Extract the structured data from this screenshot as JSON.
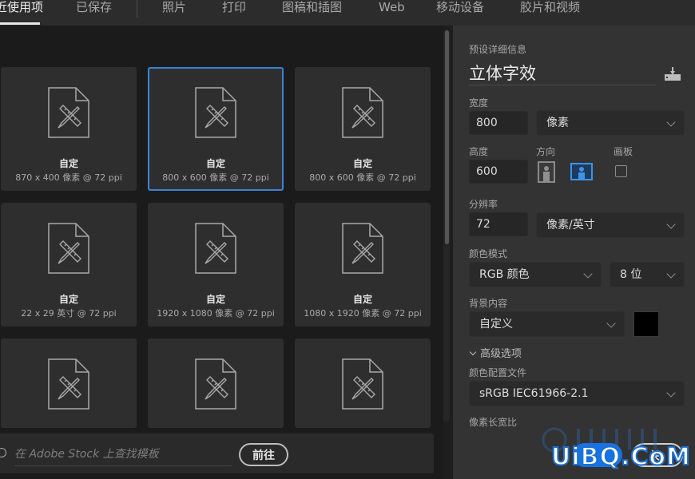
{
  "tabs": [
    {
      "label": "近使用项",
      "active": true
    },
    {
      "label": "已保存",
      "active": false
    },
    {
      "label": "照片",
      "active": false
    },
    {
      "label": "打印",
      "active": false
    },
    {
      "label": "图稿和插图",
      "active": false
    },
    {
      "label": "Web",
      "active": false
    },
    {
      "label": "移动设备",
      "active": false
    },
    {
      "label": "胶片和视频",
      "active": false
    }
  ],
  "presets": [
    {
      "name": "自定",
      "desc": "870 x 400 像素 @ 72 ppi",
      "selected": false
    },
    {
      "name": "自定",
      "desc": "800 x 600 像素 @ 72 ppi",
      "selected": true
    },
    {
      "name": "自定",
      "desc": "800 x 600 像素 @ 72 ppi",
      "selected": false
    },
    {
      "name": "自定",
      "desc": "22 x 29 英寸 @ 72 ppi",
      "selected": false
    },
    {
      "name": "自定",
      "desc": "1920 x 1080 像素 @ 72 ppi",
      "selected": false
    },
    {
      "name": "自定",
      "desc": "1080 x 1920 像素 @ 72 ppi",
      "selected": false
    },
    {
      "name": "",
      "desc": "",
      "selected": false
    },
    {
      "name": "",
      "desc": "",
      "selected": false
    },
    {
      "name": "",
      "desc": "",
      "selected": false
    }
  ],
  "stock": {
    "placeholder": "在 Adobe Stock 上查找模板",
    "go_label": "前往"
  },
  "details": {
    "section_title": "预设详细信息",
    "preset_name": "立体字效",
    "width_label": "宽度",
    "width_value": "800",
    "width_unit": "像素",
    "height_label": "高度",
    "height_value": "600",
    "orientation_label": "方向",
    "orientation_selected": "landscape",
    "artboard_label": "画板",
    "artboard_checked": false,
    "resolution_label": "分辨率",
    "resolution_value": "72",
    "resolution_unit": "像素/英寸",
    "color_mode_label": "颜色模式",
    "color_mode_value": "RGB 颜色",
    "bit_depth_value": "8 位",
    "background_label": "背景内容",
    "background_value": "自定义",
    "background_color": "#000000",
    "advanced_label": "高级选项",
    "color_profile_label": "颜色配置文件",
    "color_profile_value": "sRGB IEC61966-2.1",
    "pixel_aspect_label": "像素长宽比",
    "close_label": "关"
  },
  "colors": {
    "accent": "#1473e6",
    "selected_border": "#3b82d9"
  },
  "watermark": "UiBQ.CoM"
}
